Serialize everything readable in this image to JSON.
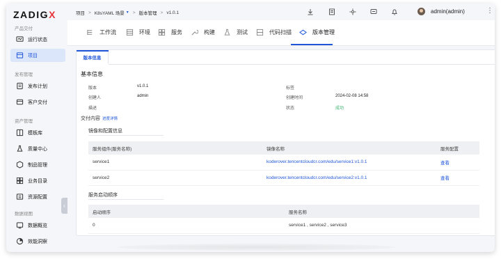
{
  "app": {
    "logo_main": "ZADIG",
    "logo_x": "X"
  },
  "sidebar": {
    "groups": [
      {
        "label": "产品交付"
      },
      {
        "label": "发布管理"
      },
      {
        "label": "资产管理"
      },
      {
        "label": "数据视图"
      }
    ],
    "items": [
      {
        "label": "运行状态",
        "icon": "monitor-icon"
      },
      {
        "label": "项目",
        "icon": "project-icon",
        "active": true
      },
      {
        "label": "发布计划",
        "icon": "plan-icon"
      },
      {
        "label": "客户交付",
        "icon": "delivery-icon"
      },
      {
        "label": "模板库",
        "icon": "template-icon"
      },
      {
        "label": "质量中心",
        "icon": "flask-icon"
      },
      {
        "label": "制品管理",
        "icon": "artifact-icon"
      },
      {
        "label": "业务目录",
        "icon": "catalog-icon"
      },
      {
        "label": "资源配置",
        "icon": "resource-icon"
      },
      {
        "label": "数据概览",
        "icon": "chart-icon"
      },
      {
        "label": "效能洞察",
        "icon": "insight-icon"
      }
    ],
    "collapse_glyph": "‹"
  },
  "header": {
    "breadcrumb": [
      "项目",
      "K8sYAML 场景",
      "版本管理",
      "v1.0.1"
    ],
    "separator": ">",
    "user_name": "admin(admin)",
    "more": "⋮"
  },
  "tabs": [
    {
      "label": "工作流",
      "icon": "workflow-icon"
    },
    {
      "label": "环境",
      "icon": "environment-icon"
    },
    {
      "label": "服务",
      "icon": "service-icon"
    },
    {
      "label": "构建",
      "icon": "build-icon"
    },
    {
      "label": "测试",
      "icon": "test-icon"
    },
    {
      "label": "代码扫描",
      "icon": "scan-icon"
    },
    {
      "label": "版本管理",
      "icon": "version-icon",
      "active": true
    }
  ],
  "content": {
    "inner_tab": "版本信息",
    "basic_title": "基本信息",
    "fields": {
      "version_label": "版本",
      "version_value": "v1.0.1",
      "tag_label": "标签",
      "tag_value": "",
      "creator_label": "创建人",
      "creator_value": "admin",
      "created_time_label": "创建时间",
      "created_time_value": "2024-02-08 14:58",
      "desc_label": "描述",
      "desc_value": "",
      "status_label": "状态",
      "status_value": "成功"
    },
    "delivery_title": "交付内容",
    "delivery_link": "进度详情",
    "images_title": "镜像和配置信息",
    "images_table": {
      "headers": [
        "服务组件(服务名称)",
        "镜像名称",
        "服务配置"
      ],
      "rows": [
        {
          "service": "service1",
          "image": "koderover.tencentcloudcr.com/edu/service1:v1.0.1",
          "action": "查看"
        },
        {
          "service": "service2",
          "image": "koderover.tencentcloudcr.com/edu/service2:v1.0.1",
          "action": "查看"
        }
      ]
    },
    "order_title": "服务启动顺序",
    "order_table": {
      "headers": [
        "启动顺序",
        "服务名称"
      ],
      "rows": [
        {
          "order": "0",
          "services": "service1 , service2 , service3"
        }
      ]
    }
  },
  "colors": {
    "accent": "#1f56d9",
    "success": "#3cb371",
    "logo_x": "#e8333b"
  }
}
